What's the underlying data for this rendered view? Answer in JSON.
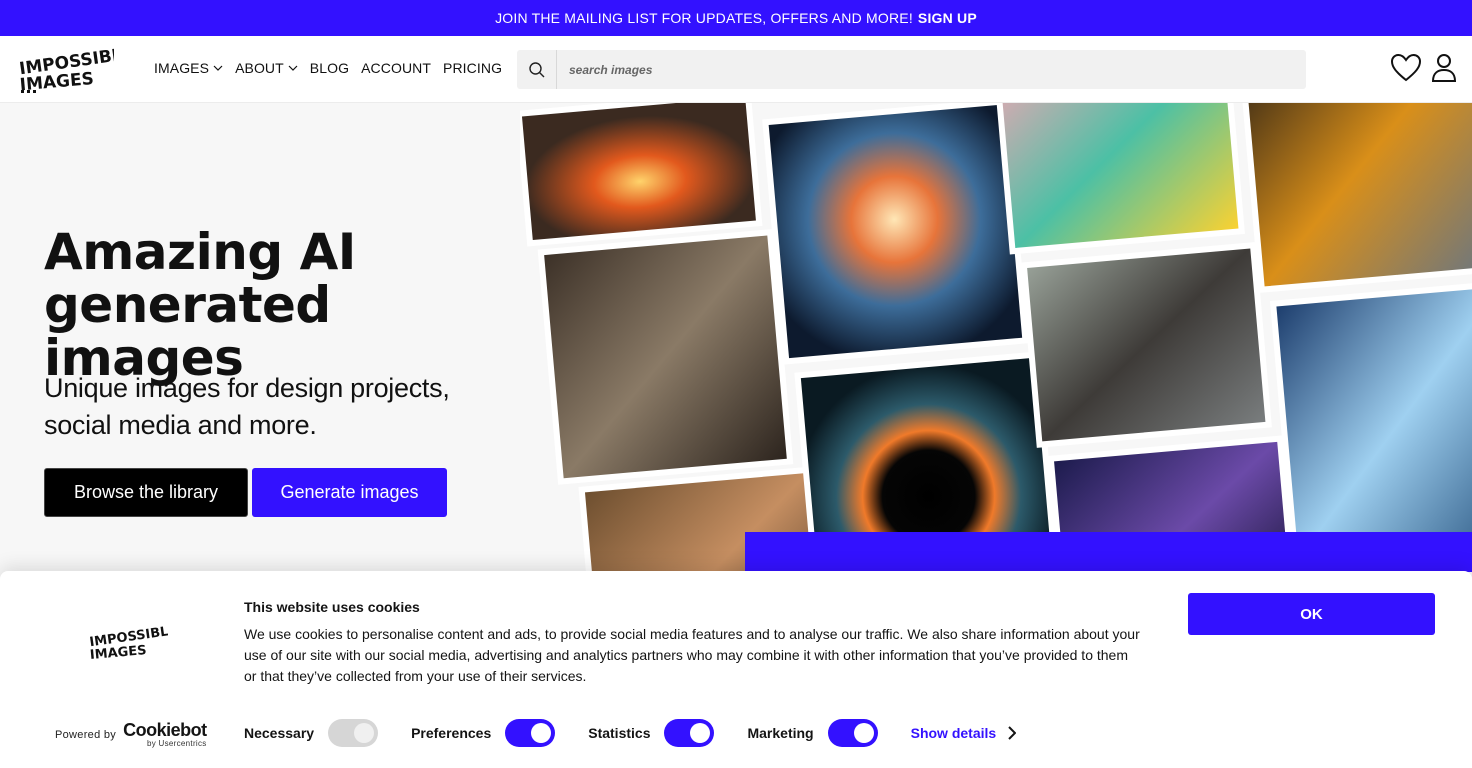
{
  "promo": {
    "text": "JOIN THE MAILING LIST FOR UPDATES, OFFERS AND MORE!",
    "link": "SIGN UP"
  },
  "brand": {
    "logo_line1": "IMPOSSIBLE",
    "logo_line2": "IMAGES",
    "accent": "#3311ff"
  },
  "nav": {
    "images": "IMAGES",
    "about": "ABOUT",
    "blog": "BLOG",
    "account": "ACCOUNT",
    "pricing": "PRICING"
  },
  "search": {
    "placeholder": "search images",
    "icon": "search-icon"
  },
  "header_icons": {
    "favorites": "heart-icon",
    "user": "user-icon"
  },
  "hero": {
    "title_line1": "Amazing AI",
    "title_line2": "generated images",
    "subtitle": "Unique images for design projects, social media and more.",
    "browse_label": "Browse the library",
    "generate_label": "Generate images"
  },
  "cookie": {
    "title": "This website uses cookies",
    "text": "We use cookies to personalise content and ads, to provide social media features and to analyse our traffic. We also share information about your use of our site with our social media, advertising and analytics partners who may combine it with other information that you’ve provided to them or that they’ve collected from your use of their services.",
    "ok_label": "OK",
    "powered_by": "Powered by",
    "cookiebot": "Cookiebot",
    "by_usercentrics": "by Usercentrics",
    "toggles": [
      {
        "label": "Necessary",
        "state": "on-disabled"
      },
      {
        "label": "Preferences",
        "state": "on"
      },
      {
        "label": "Statistics",
        "state": "on"
      },
      {
        "label": "Marketing",
        "state": "on"
      }
    ],
    "show_details": "Show details"
  }
}
